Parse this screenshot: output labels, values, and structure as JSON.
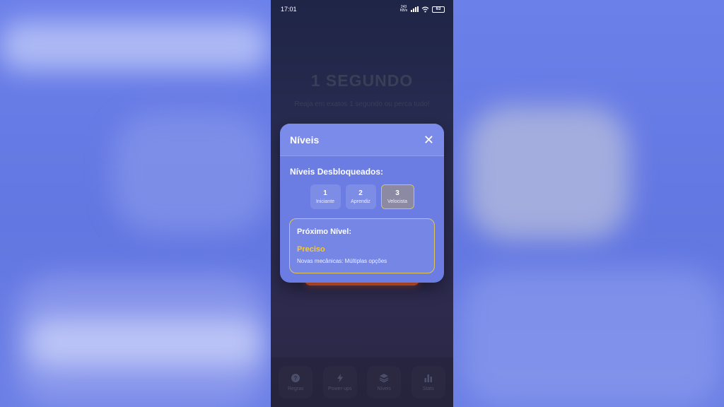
{
  "status_bar": {
    "time": "17:01",
    "net_speed_value": "243",
    "net_speed_unit": "KB/s",
    "battery": "63"
  },
  "game": {
    "title": "1 SEGUNDO",
    "subtitle": "Reaja em exatos 1 segundo ou perca tudo!"
  },
  "modal": {
    "title": "Níveis",
    "close_symbol": "✕",
    "unlocked_label": "Níveis Desbloqueados:",
    "levels": [
      {
        "number": "1",
        "name": "Iniciante"
      },
      {
        "number": "2",
        "name": "Aprendiz"
      },
      {
        "number": "3",
        "name": "Velocista"
      }
    ],
    "next": {
      "label": "Próximo Nível:",
      "name": "Preciso",
      "description": "Novas mecânicas: Múltiplas opções"
    }
  },
  "bottom_nav": [
    {
      "label": "Regras",
      "icon": "question-circle-icon"
    },
    {
      "label": "Power-ups",
      "icon": "lightning-icon"
    },
    {
      "label": "Níveis",
      "icon": "layers-icon"
    },
    {
      "label": "Stats",
      "icon": "bar-chart-icon"
    }
  ],
  "colors": {
    "accent": "#6b7de2",
    "next_level_highlight": "#f6c935",
    "start_button": "#e55a2b"
  }
}
